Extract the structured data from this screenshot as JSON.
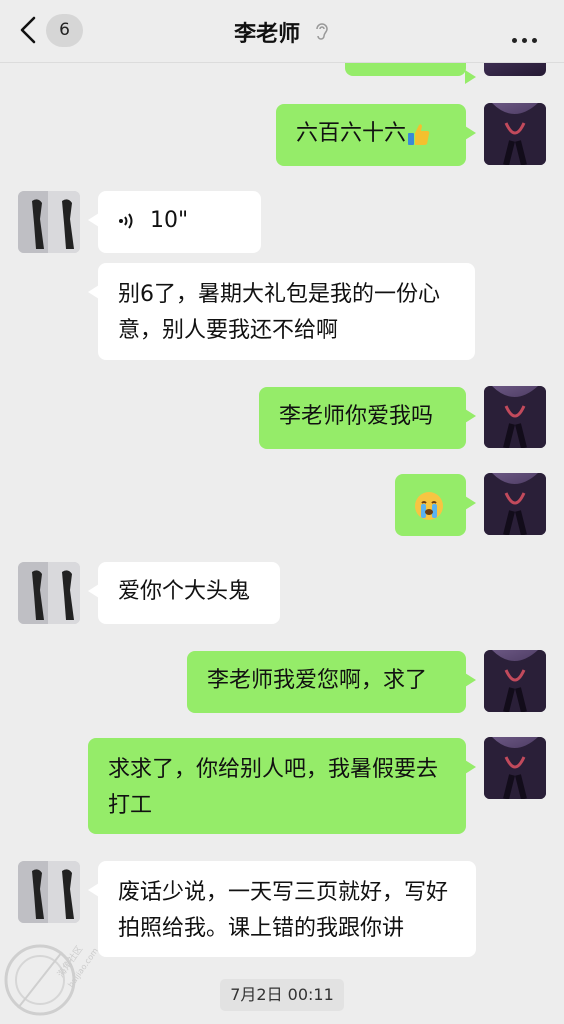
{
  "header": {
    "back_badge": "6",
    "title": "李老师"
  },
  "messages": [
    {
      "side": "right",
      "text": "六百六十六",
      "emoji": "thumbs-up"
    },
    {
      "side": "left",
      "type": "voice",
      "text": "10\""
    },
    {
      "side": "left",
      "text": "别6了，暑期大礼包是我的一份心意，别人要我还不给啊"
    },
    {
      "side": "right",
      "text": "李老师你爱我吗"
    },
    {
      "side": "right",
      "emoji": "crying-face"
    },
    {
      "side": "left",
      "text": "爱你个大头鬼"
    },
    {
      "side": "right",
      "text": "李老师我爱您啊，求了"
    },
    {
      "side": "right",
      "text": "求求了，你给别人吧，我暑假要去打工"
    },
    {
      "side": "left",
      "text": "废话少说，一天写三页就好，写好拍照给我。课上错的我跟你讲"
    }
  ],
  "timestamp": "7月2日 00:11",
  "watermark": {
    "line1": "海角社区",
    "line2": "haijiao.com"
  },
  "colors": {
    "green_bubble": "#95ec69",
    "white_bubble": "#ffffff",
    "background": "#ededed"
  }
}
